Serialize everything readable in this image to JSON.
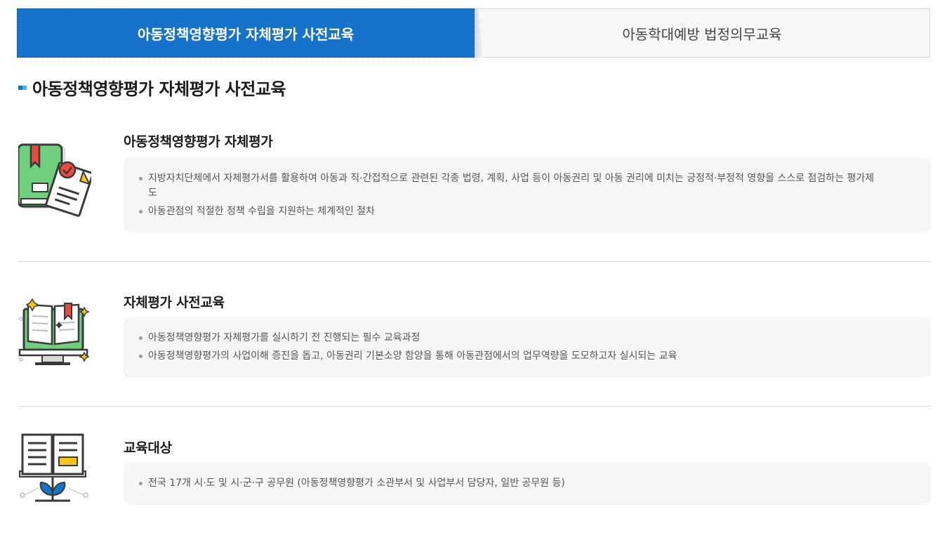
{
  "tabs": [
    {
      "label": "아동정책영향평가 자체평가 사전교육",
      "active": true
    },
    {
      "label": "아동학대예방 법정의무교육",
      "active": false
    }
  ],
  "section_title": "아동정책영향평가 자체평가 사전교육",
  "colors": {
    "accent": "#1673c9",
    "icon_green": "#6fcf7c",
    "icon_red": "#e74c3c",
    "icon_yellow": "#f5c518"
  },
  "blocks": [
    {
      "title": "아동정책영향평가 자체평가",
      "icon": "book-checklist-icon",
      "items": [
        "지방자치단체에서 자체평가서를 활용하여 아동과 직·간접적으로 관련된 각종 법령, 계획, 사업 등이 아동권리 및 아동 권리에 미치는 긍정적·부정적 영향을 스스로 점검하는 평가제도",
        "아동관점의 적절한 정책 수립을 지원하는 체계적인 절차"
      ]
    },
    {
      "title": "자체평가 사전교육",
      "icon": "online-book-monitor-icon",
      "items": [
        "아동정책영향평가 자체평가를 실시하기 전 진행되는 필수 교육과정",
        "아동정책영향평가의 사업이해 증진을 돕고, 아동권리 기본소양 함양을 통해 아동관점에서의 업무역량을 도모하고자 실시되는 교육"
      ]
    },
    {
      "title": "교육대상",
      "icon": "open-book-plant-icon",
      "items": [
        "전국 17개 시·도 및 시·군·구 공무원 (아동정책영향평가 소관부서 및 사업부서 담당자, 일반 공무원 등)"
      ]
    }
  ]
}
